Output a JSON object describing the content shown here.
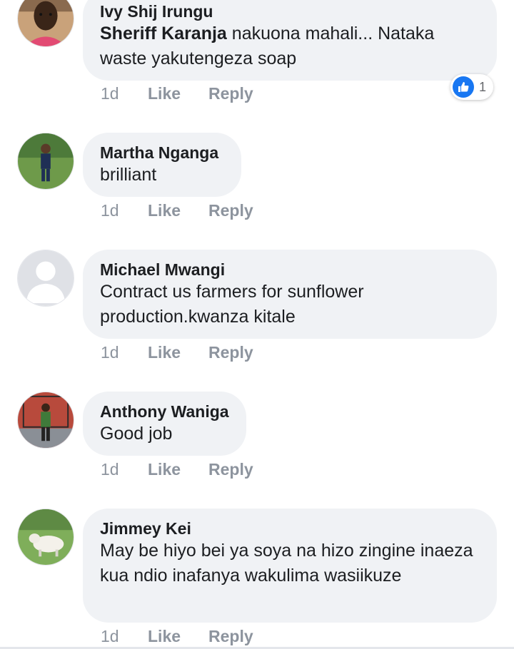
{
  "comments": [
    {
      "author": "Ivy Shij Irungu",
      "mention": "Sheriff Karanja",
      "text": " nakuona mahali... Nataka waste yakutengeza soap",
      "time": "1d",
      "like": "Like",
      "reply": "Reply",
      "reaction_count": "1",
      "avatar": "girl-portrait"
    },
    {
      "author": "Martha Nganga",
      "text": "brilliant",
      "time": "1d",
      "like": "Like",
      "reply": "Reply",
      "avatar": "child-in-suit-on-grass"
    },
    {
      "author": "Michael Mwangi",
      "text": "Contract us farmers for sunflower production.kwanza kitale",
      "time": "1d",
      "like": "Like",
      "reply": "Reply",
      "avatar": "default-silhouette"
    },
    {
      "author": "Anthony Waniga",
      "text": "Good job",
      "time": "1d",
      "like": "Like",
      "reply": "Reply",
      "avatar": "man-standing-at-gate"
    },
    {
      "author": "Jimmey Kei",
      "text": "May be hiyo bei ya soya na hizo zingine inaeza kua ndio inafanya wakulima wasiikuze",
      "time": "1d",
      "like": "Like",
      "reply": "Reply",
      "avatar": "lamb-on-grass"
    }
  ],
  "colors": {
    "bubble": "#f0f2f5",
    "action_text": "#8d949e",
    "like_blue": "#1877f2"
  }
}
